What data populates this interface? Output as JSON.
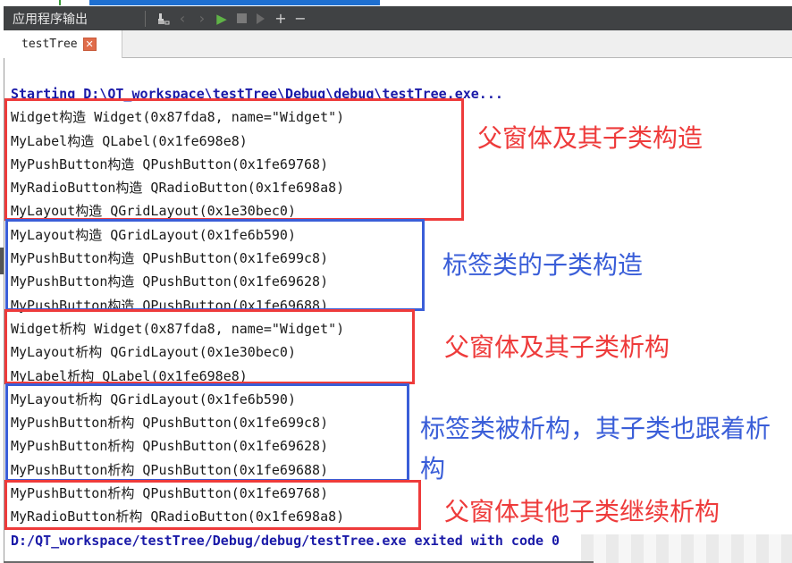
{
  "window": {
    "panel_title": "应用程序输出",
    "toolbar": [
      {
        "icon": "clear-output-icon",
        "glyph": "🧹",
        "enabled": true
      },
      {
        "icon": "chevron-left-icon",
        "glyph": "‹",
        "enabled": false
      },
      {
        "icon": "chevron-right-icon",
        "glyph": "›",
        "enabled": false
      },
      {
        "icon": "run-icon",
        "glyph": "▶",
        "enabled": true
      },
      {
        "icon": "stop-icon",
        "glyph": "■",
        "enabled": false
      },
      {
        "icon": "debug-attach-icon",
        "glyph": "⯈",
        "enabled": false
      },
      {
        "icon": "zoom-in-icon",
        "glyph": "+",
        "enabled": true
      },
      {
        "icon": "zoom-out-icon",
        "glyph": "−",
        "enabled": true
      }
    ],
    "tab": {
      "label": "testTree",
      "close_glyph": "✕"
    }
  },
  "output": {
    "start_line": "Starting D:\\QT_workspace\\testTree\\Debug\\debug\\testTree.exe...",
    "lines": [
      "Widget构造 Widget(0x87fda8, name=\"Widget\")",
      "MyLabel构造 QLabel(0x1fe698e8)",
      "MyPushButton构造 QPushButton(0x1fe69768)",
      "MyRadioButton构造 QRadioButton(0x1fe698a8)",
      "MyLayout构造 QGridLayout(0x1e30bec0)",
      "MyLayout构造 QGridLayout(0x1fe6b590)",
      "MyPushButton构造 QPushButton(0x1fe699c8)",
      "MyPushButton构造 QPushButton(0x1fe69628)",
      "MyPushButton构造 QPushButton(0x1fe69688)",
      "Widget析构 Widget(0x87fda8, name=\"Widget\")",
      "MyLayout析构 QGridLayout(0x1e30bec0)",
      "MyLabel析构 QLabel(0x1fe698e8)",
      "MyLayout析构 QGridLayout(0x1fe6b590)",
      "MyPushButton析构 QPushButton(0x1fe699c8)",
      "MyPushButton析构 QPushButton(0x1fe69628)",
      "MyPushButton析构 QPushButton(0x1fe69688)",
      "MyPushButton析构 QPushButton(0x1fe69768)",
      "MyRadioButton析构 QRadioButton(0x1fe698a8)"
    ],
    "end_line": "D:/QT_workspace/testTree/Debug/debug/testTree.exe exited with code 0"
  },
  "annotations": [
    {
      "text": "父窗体及其子类构造",
      "color": "#ee3b3b"
    },
    {
      "text": "标签类的子类构造",
      "color": "#3a5ed8"
    },
    {
      "text": "父窗体及其子类析构",
      "color": "#ee3b3b"
    },
    {
      "text": "标签类被析构，其子类也跟着析构",
      "color": "#3a5ed8"
    },
    {
      "text": "父窗体其他子类继续析构",
      "color": "#ee3b3b"
    }
  ]
}
